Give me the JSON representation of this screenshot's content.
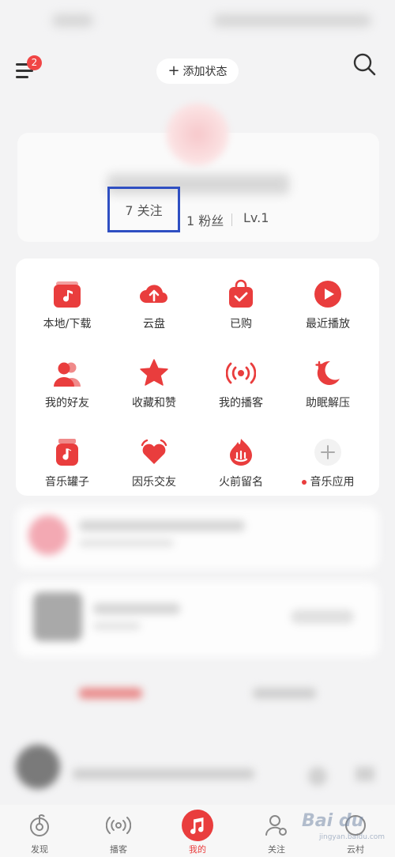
{
  "header": {
    "menu_badge": "2",
    "add_status_label": "添加状态"
  },
  "profile": {
    "following": "7 关注",
    "fans": "1 粉丝",
    "level": "Lv.1"
  },
  "grid": [
    {
      "label": "本地/下载",
      "icon": "local-download-icon"
    },
    {
      "label": "云盘",
      "icon": "cloud-upload-icon"
    },
    {
      "label": "已购",
      "icon": "shopping-bag-icon"
    },
    {
      "label": "最近播放",
      "icon": "play-circle-icon"
    },
    {
      "label": "我的好友",
      "icon": "friends-icon"
    },
    {
      "label": "收藏和赞",
      "icon": "star-icon"
    },
    {
      "label": "我的播客",
      "icon": "broadcast-icon"
    },
    {
      "label": "助眠解压",
      "icon": "moon-icon"
    },
    {
      "label": "音乐罐子",
      "icon": "music-jar-icon"
    },
    {
      "label": "因乐交友",
      "icon": "heart-icon"
    },
    {
      "label": "火前留名",
      "icon": "fire-icon"
    },
    {
      "label": "音乐应用",
      "icon": "plus-icon"
    }
  ],
  "tabs": [
    {
      "label": "发现",
      "icon": "discover-icon"
    },
    {
      "label": "播客",
      "icon": "podcast-icon"
    },
    {
      "label": "我的",
      "icon": "music-note-icon"
    },
    {
      "label": "关注",
      "icon": "follow-icon"
    },
    {
      "label": "云村",
      "icon": "community-icon"
    }
  ],
  "watermark": {
    "brand": "Bai du",
    "site": "jingyan.baidu.com"
  },
  "colors": {
    "accent": "#e93d3d",
    "highlight_box": "#2f4fc2"
  }
}
